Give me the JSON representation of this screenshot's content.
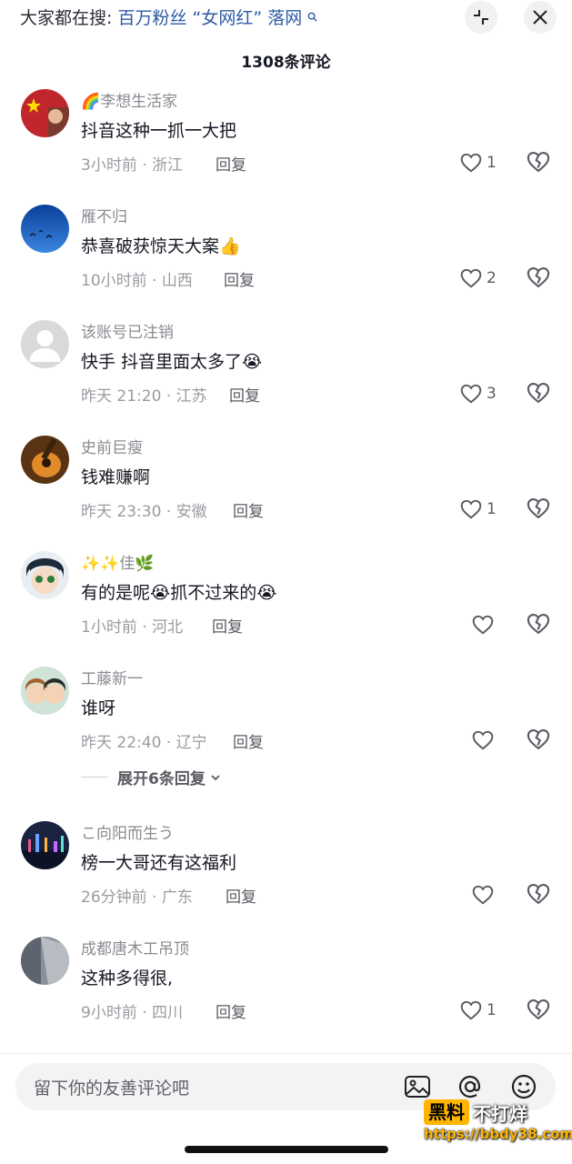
{
  "header": {
    "search_prefix": "大家都在搜:",
    "search_query": "百万粉丝 “女网红” 落网",
    "comment_count_title": "1308条评论"
  },
  "comments": [
    {
      "username": "🌈李想生活家",
      "text": "抖音这种一抓一大把",
      "meta": "3小时前 · 浙江",
      "reply": "回复",
      "likes": "1"
    },
    {
      "username": "雁不归",
      "text": "恭喜破获惊天大案👍",
      "meta": "10小时前 · 山西",
      "reply": "回复",
      "likes": "2"
    },
    {
      "username": "该账号已注销",
      "text": "快手  抖音里面太多了😭",
      "meta": "昨天 21:20 · 江苏",
      "reply": "回复",
      "likes": "3"
    },
    {
      "username": "史前巨瘦",
      "text": "钱难赚啊",
      "meta": "昨天 23:30 · 安徽",
      "reply": "回复",
      "likes": "1"
    },
    {
      "username": "✨✨佳🌿",
      "text": "有的是呢😭抓不过来的😭",
      "meta": "1小时前 · 河北",
      "reply": "回复",
      "likes": ""
    },
    {
      "username": "工藤新一",
      "text": "谁呀",
      "meta": "昨天 22:40 · 辽宁",
      "reply": "回复",
      "likes": ""
    },
    {
      "username": "こ向阳而生う",
      "text": "榜一大哥还有这福利",
      "meta": "26分钟前 · 广东",
      "reply": "回复",
      "likes": ""
    },
    {
      "username": "成都唐木工吊顶",
      "text": "这种多得很,",
      "meta": "9小时前 · 四川",
      "reply": "回复",
      "likes": "1"
    }
  ],
  "expand_replies": "展开6条回复",
  "composer": {
    "placeholder": "留下你的友善评论吧"
  },
  "watermark": {
    "tag": "黑料",
    "text": "不打烊",
    "url": "https://bbdy38.com"
  },
  "icons": {
    "collapse": "collapse-icon",
    "close": "close-icon",
    "like": "heart-icon",
    "dislike": "broken-heart-icon",
    "image": "image-icon",
    "mention": "at-icon",
    "emoji": "emoji-icon"
  },
  "colors": {
    "query_link": "#2c5aa3",
    "muted_text": "#9a9ba1",
    "watermark_accent": "#ffb400"
  }
}
